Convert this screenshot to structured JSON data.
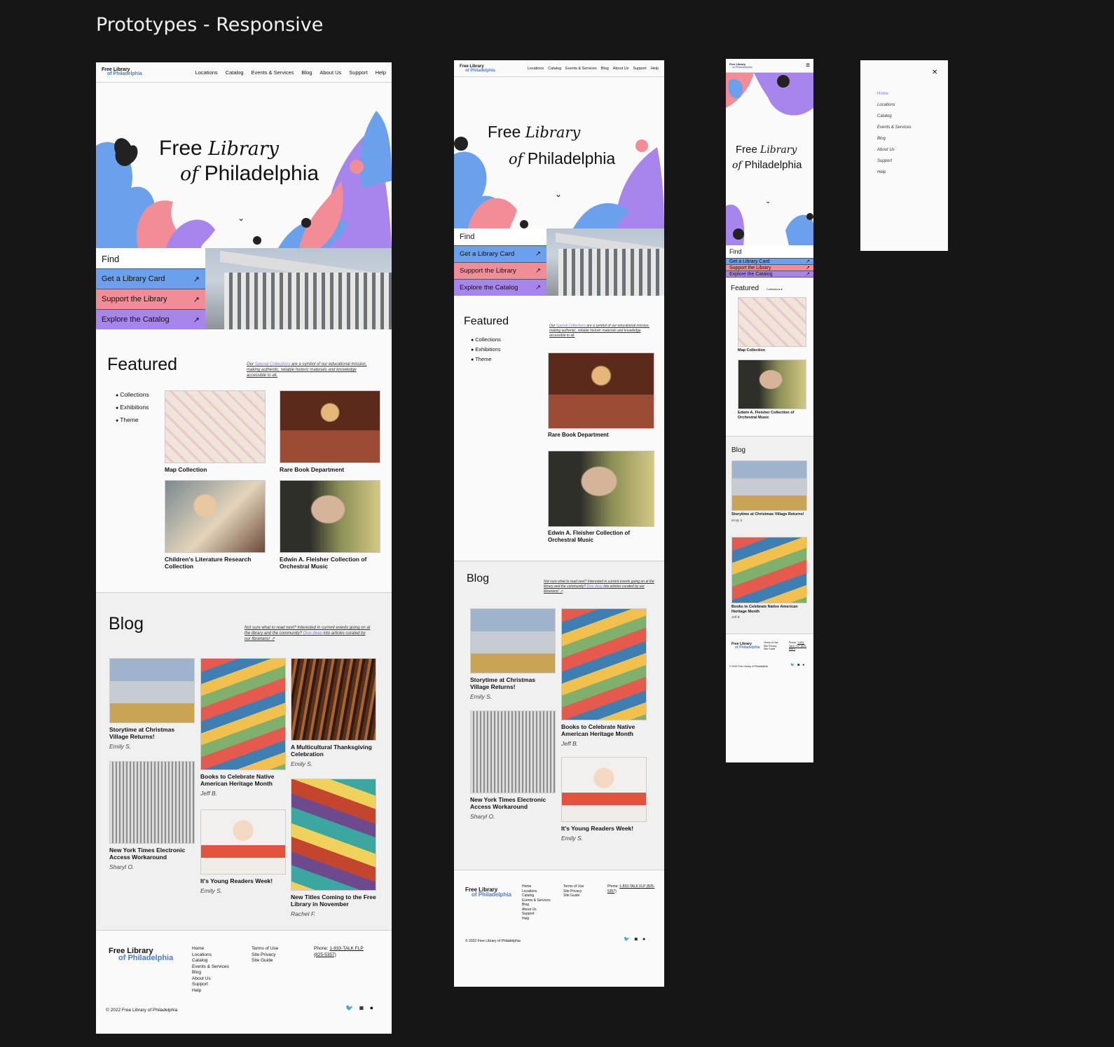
{
  "page_title": "Prototypes - Responsive",
  "brand": {
    "line1": "Free Library",
    "line2": "of Philadelphia"
  },
  "hero": {
    "free": "Free",
    "library": "Library",
    "of": "of",
    "philadelphia": "Philadelphia",
    "chevron": "⌄"
  },
  "nav": [
    "Locations",
    "Catalog",
    "Events & Services",
    "Blog",
    "About Us",
    "Support",
    "Help"
  ],
  "find": {
    "title": "Find",
    "arrow": "↗",
    "buttons": [
      "Get a Library Card",
      "Support the Library",
      "Explore the Catalog"
    ]
  },
  "featured": {
    "title": "Featured",
    "blurb_pre": "Our ",
    "blurb_link": "Special Collections",
    "blurb_post": " are a symbol of our educational mission, making authentic, reliable historic materials and knowledge accessible to all.",
    "bullets": [
      "Collections",
      "Exhibitions",
      "Theme"
    ],
    "mobile_dropdown": "Collections ▾",
    "cards": [
      "Map Collection",
      "Rare Book Department",
      "Children's Literature Research Collection",
      "Edwin A. Fleisher Collection of Orchestral Music"
    ]
  },
  "blog": {
    "title": "Blog",
    "blurb_pre": "Not sure what to read next? Interested in current events going on at the library and the community? ",
    "blurb_link": "Dive deep",
    "blurb_post": " into articles curated by our librarians! ↗",
    "posts": [
      {
        "title": "Storytime at Christmas Village Returns!",
        "author": "Emily S."
      },
      {
        "title": "Books to Celebrate Native American Heritage Month",
        "author": "Jeff B."
      },
      {
        "title": "A Multicultural Thanksgiving Celebration",
        "author": "Emily S."
      },
      {
        "title": "New York Times Electronic Access Workaround",
        "author": "Sharyl O."
      },
      {
        "title": "It's Young Readers Week!",
        "author": "Emily S."
      },
      {
        "title": "New Titles Coming to the Free Library in November",
        "author": "Rachel F."
      }
    ]
  },
  "footer": {
    "links1": [
      "Home",
      "Locations",
      "Catalog",
      "Events & Services",
      "Blog",
      "About Us",
      "Support",
      "Help"
    ],
    "links2": [
      "Terms of Use",
      "Site Privacy",
      "Site Guide"
    ],
    "phone_label": "Phone: ",
    "phone": "1-833-TALK FLP (825-5357)",
    "copyright": "© 2022 Free Library of Philadelphia",
    "social": [
      "twitter-icon",
      "instagram-icon",
      "facebook-icon"
    ]
  },
  "mobile_menu": {
    "close": "✕",
    "items": [
      "Home",
      "Locations",
      "Catalog",
      "Events & Services",
      "Blog",
      "About Us",
      "Support",
      "Help"
    ],
    "active_color": "#8a6fe0"
  },
  "colors": {
    "blue": "#6aa0ec",
    "pink": "#f28d98",
    "purple": "#a785ec",
    "background": "#161616"
  }
}
